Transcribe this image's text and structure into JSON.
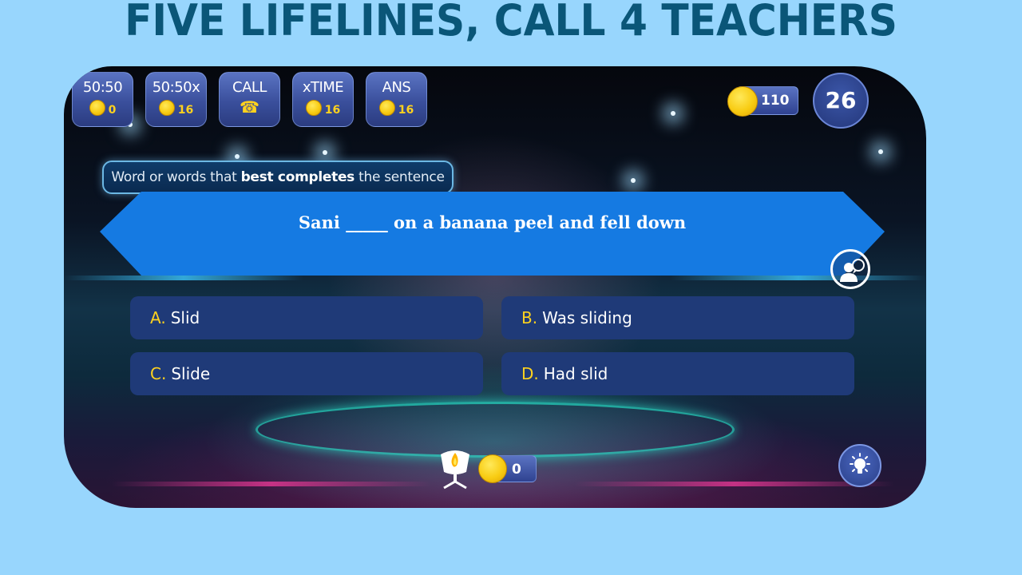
{
  "banner": {
    "title": "FIVE LIFELINES, CALL 4 TEACHERS"
  },
  "lifelines": [
    {
      "label": "50:50",
      "cost": "0",
      "icon": "coin-icon"
    },
    {
      "label": "50:50x",
      "cost": "16",
      "icon": "coin-icon"
    },
    {
      "label": "CALL",
      "icon": "phone-icon"
    },
    {
      "label": "xTIME",
      "cost": "16",
      "icon": "coin-icon"
    },
    {
      "label": "ANS",
      "cost": "16",
      "icon": "coin-icon"
    }
  ],
  "status": {
    "coins": "110",
    "timer": "26"
  },
  "question": {
    "instruction_pre": "Word or words that ",
    "instruction_bold": "best completes",
    "instruction_post": " the sentence",
    "text": "Sani _____ on a banana peel and fell down"
  },
  "answers": [
    {
      "letter": "A.",
      "text": "Slid"
    },
    {
      "letter": "B.",
      "text": "Was sliding"
    },
    {
      "letter": "C.",
      "text": "Slide"
    },
    {
      "letter": "D.",
      "text": "Had slid"
    }
  ],
  "footer": {
    "earned": "0"
  },
  "colors": {
    "background": "#98d6fd",
    "title": "#0a5678",
    "question_banner": "#157ae2",
    "answer_box": "#1f3a78",
    "answer_letter": "#ffd21e",
    "coin": "#f8cc13"
  }
}
